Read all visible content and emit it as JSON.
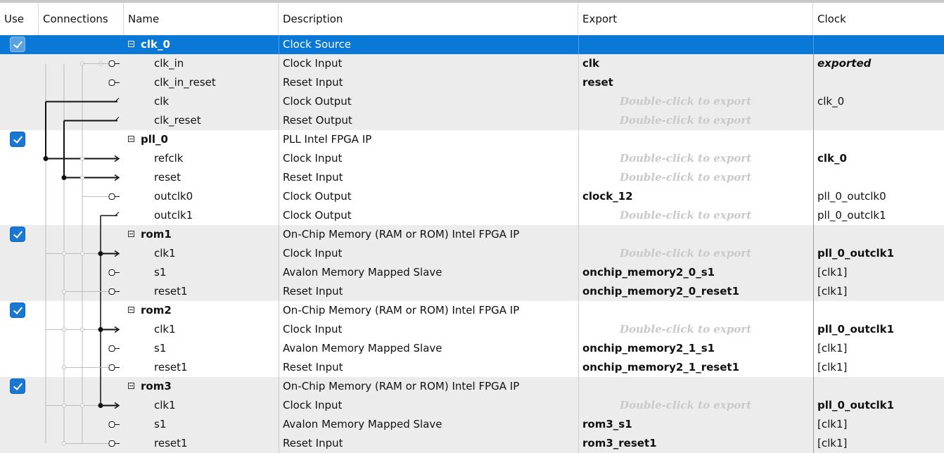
{
  "columns": {
    "use": "Use",
    "connections": "Connections",
    "name": "Name",
    "description": "Description",
    "export": "Export",
    "clock": "Clock"
  },
  "export_hint": "Double-click to export",
  "colors": {
    "selection": "#0a78d6",
    "checkbox": "#1a78d3",
    "hint_text": "#c9c9c9",
    "alt_row": "#ececec"
  },
  "rows": [
    {
      "type": "component",
      "name": "clk_0",
      "description": "Clock Source",
      "export": "",
      "clock": "",
      "use": true,
      "selected": true,
      "group": 0
    },
    {
      "type": "interface",
      "name": "clk_in",
      "description": "Clock Input",
      "export": "clk",
      "clock": "exported",
      "clock_style": "italic-bold",
      "conn": "exp-in",
      "group": 0
    },
    {
      "type": "interface",
      "name": "clk_in_reset",
      "description": "Reset Input",
      "export": "reset",
      "clock": "",
      "conn": "exp-in-only",
      "group": 0
    },
    {
      "type": "interface",
      "name": "clk",
      "description": "Clock Output",
      "export": "",
      "clock": "clk_0",
      "conn": "out",
      "group": 0
    },
    {
      "type": "interface",
      "name": "clk_reset",
      "description": "Reset Output",
      "export": "",
      "clock": "",
      "conn": "out",
      "group": 0
    },
    {
      "type": "component",
      "name": "pll_0",
      "description": "PLL Intel FPGA IP",
      "export": "",
      "clock": "",
      "use": true,
      "group": 1
    },
    {
      "type": "interface",
      "name": "refclk",
      "description": "Clock Input",
      "export": "",
      "clock": "clk_0",
      "clock_style": "bold",
      "conn": "in",
      "group": 1
    },
    {
      "type": "interface",
      "name": "reset",
      "description": "Reset Input",
      "export": "",
      "clock": "",
      "conn": "in",
      "group": 1
    },
    {
      "type": "interface",
      "name": "outclk0",
      "description": "Clock Output",
      "export": "clock_12",
      "clock": "pll_0_outclk0",
      "conn": "exp-out",
      "group": 1
    },
    {
      "type": "interface",
      "name": "outclk1",
      "description": "Clock Output",
      "export": "",
      "clock": "pll_0_outclk1",
      "conn": "out",
      "group": 1
    },
    {
      "type": "component",
      "name": "rom1",
      "description": "On-Chip Memory (RAM or ROM) Intel FPGA IP",
      "export": "",
      "clock": "",
      "use": true,
      "group": 2
    },
    {
      "type": "interface",
      "name": "clk1",
      "description": "Clock Input",
      "export": "",
      "clock": "pll_0_outclk1",
      "clock_style": "bold",
      "conn": "in",
      "group": 2
    },
    {
      "type": "interface",
      "name": "s1",
      "description": "Avalon Memory Mapped Slave",
      "export": "onchip_memory2_0_s1",
      "clock": "[clk1]",
      "conn": "exp-in-only",
      "group": 2
    },
    {
      "type": "interface",
      "name": "reset1",
      "description": "Reset Input",
      "export": "onchip_memory2_0_reset1",
      "clock": "[clk1]",
      "conn": "exp-in-only",
      "group": 2
    },
    {
      "type": "component",
      "name": "rom2",
      "description": "On-Chip Memory (RAM or ROM) Intel FPGA IP",
      "export": "",
      "clock": "",
      "use": true,
      "group": 3
    },
    {
      "type": "interface",
      "name": "clk1",
      "description": "Clock Input",
      "export": "",
      "clock": "pll_0_outclk1",
      "clock_style": "bold",
      "conn": "in",
      "group": 3
    },
    {
      "type": "interface",
      "name": "s1",
      "description": "Avalon Memory Mapped Slave",
      "export": "onchip_memory2_1_s1",
      "clock": "[clk1]",
      "conn": "exp-in-only",
      "group": 3
    },
    {
      "type": "interface",
      "name": "reset1",
      "description": "Reset Input",
      "export": "onchip_memory2_1_reset1",
      "clock": "[clk1]",
      "conn": "exp-in-only",
      "group": 3
    },
    {
      "type": "component",
      "name": "rom3",
      "description": "On-Chip Memory (RAM or ROM) Intel FPGA IP",
      "export": "",
      "clock": "",
      "use": true,
      "group": 4
    },
    {
      "type": "interface",
      "name": "clk1",
      "description": "Clock Input",
      "export": "",
      "clock": "pll_0_outclk1",
      "clock_style": "bold",
      "conn": "in",
      "group": 4
    },
    {
      "type": "interface",
      "name": "s1",
      "description": "Avalon Memory Mapped Slave",
      "export": "rom3_s1",
      "clock": "[clk1]",
      "conn": "exp-in-only",
      "group": 4
    },
    {
      "type": "interface",
      "name": "reset1",
      "description": "Reset Input",
      "export": "rom3_reset1",
      "clock": "[clk1]",
      "conn": "exp-in-only",
      "group": 4
    }
  ]
}
